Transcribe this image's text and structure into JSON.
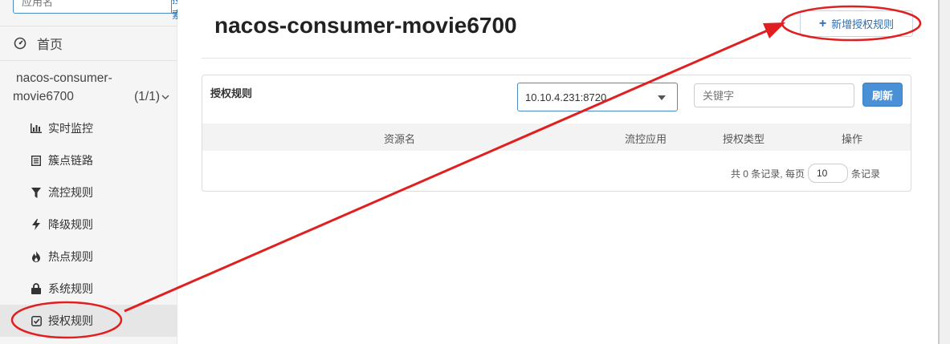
{
  "sidebar": {
    "search_placeholder": "应用名",
    "search_button": "搜索",
    "home_label": "首页",
    "app_name_line1": "nacos-consumer-",
    "app_name_line2": "movie6700",
    "app_count": "(1/1)",
    "items": [
      {
        "label": "实时监控",
        "icon": "bar-chart-icon"
      },
      {
        "label": "簇点链路",
        "icon": "list-icon"
      },
      {
        "label": "流控规则",
        "icon": "filter-icon"
      },
      {
        "label": "降级规则",
        "icon": "bolt-icon"
      },
      {
        "label": "热点规则",
        "icon": "fire-icon"
      },
      {
        "label": "系统规则",
        "icon": "lock-icon"
      },
      {
        "label": "授权规则",
        "icon": "check-square-icon",
        "active": true
      }
    ]
  },
  "main": {
    "title": "nacos-consumer-movie6700",
    "add_button": "新增授权规则",
    "panel_title": "授权规则",
    "machine_select": "10.10.4.231:8720",
    "keyword_placeholder": "关键字",
    "refresh_button": "刷新",
    "columns": [
      "资源名",
      "流控应用",
      "授权类型",
      "操作"
    ],
    "pager": {
      "prefix": "共 0 条记录, 每页",
      "page_size": "10",
      "suffix": "条记录"
    }
  },
  "colors": {
    "accent": "#4a90d6",
    "annotation": "#e02020"
  }
}
